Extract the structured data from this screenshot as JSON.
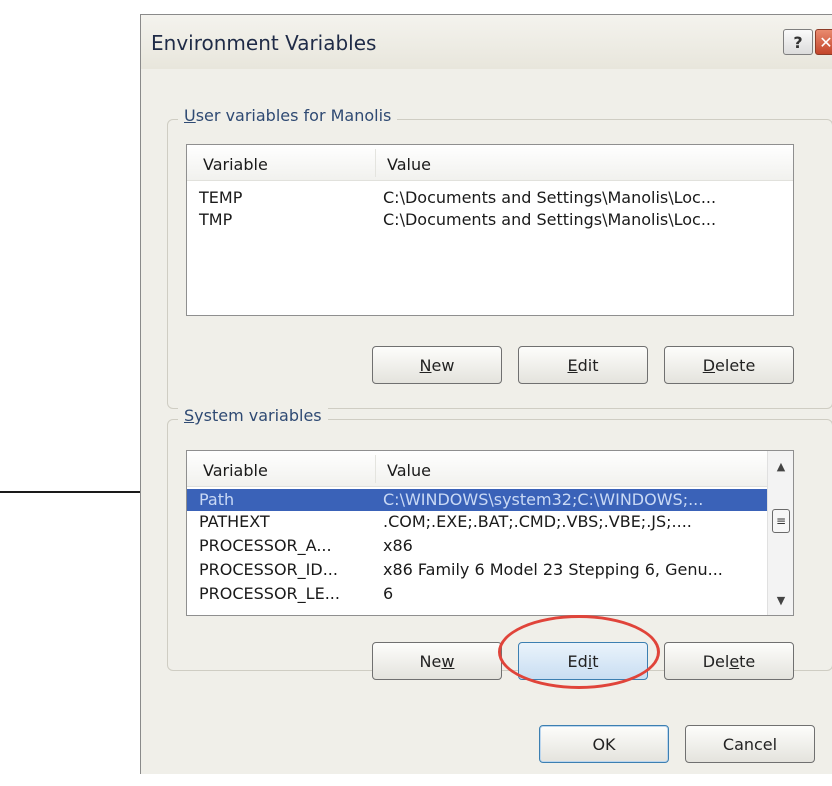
{
  "window": {
    "title": "Environment Variables",
    "help_glyph": "?",
    "close_glyph": "✕"
  },
  "user_vars": {
    "label_prefix": "U",
    "label_rest": "ser variables for Manolis",
    "columns": [
      "Variable",
      "Value"
    ],
    "rows": [
      {
        "name": "TEMP",
        "value": "C:\\Documents and Settings\\Manolis\\Loc..."
      },
      {
        "name": "TMP",
        "value": "C:\\Documents and Settings\\Manolis\\Loc..."
      }
    ],
    "buttons": {
      "new": {
        "pre": "",
        "key": "N",
        "post": "ew"
      },
      "edit": {
        "pre": "",
        "key": "E",
        "post": "dit"
      },
      "delete": {
        "pre": "",
        "key": "D",
        "post": "elete"
      }
    }
  },
  "system_vars": {
    "label_prefix": "S",
    "label_rest": "ystem variables",
    "columns": [
      "Variable",
      "Value"
    ],
    "rows": [
      {
        "name": "Path",
        "value": "C:\\WINDOWS\\system32;C:\\WINDOWS;...",
        "selected": true
      },
      {
        "name": "PATHEXT",
        "value": ".COM;.EXE;.BAT;.CMD;.VBS;.VBE;.JS;....",
        "selected": false
      },
      {
        "name": "PROCESSOR_A...",
        "value": "x86",
        "selected": false
      },
      {
        "name": "PROCESSOR_ID...",
        "value": "x86 Family 6 Model 23 Stepping 6, Genu...",
        "selected": false
      },
      {
        "name": "PROCESSOR_LE...",
        "value": "6",
        "selected": false
      }
    ],
    "buttons": {
      "new": {
        "pre": "Ne",
        "key": "w",
        "post": ""
      },
      "edit": {
        "pre": "Ed",
        "key": "i",
        "post": "t"
      },
      "delete": {
        "pre": "Del",
        "key": "e",
        "post": "te"
      }
    },
    "scroll_up": "▲",
    "scroll_down": "▼",
    "scroll_thumb": "≡"
  },
  "footer": {
    "ok_label": "OK",
    "cancel_label": "Cancel"
  },
  "annotation_colors": {
    "circle": "#e0443a",
    "arrow": "#1a1a1a"
  },
  "colors": {
    "selection": "#3a62b8",
    "group_label": "#2f4a73"
  }
}
